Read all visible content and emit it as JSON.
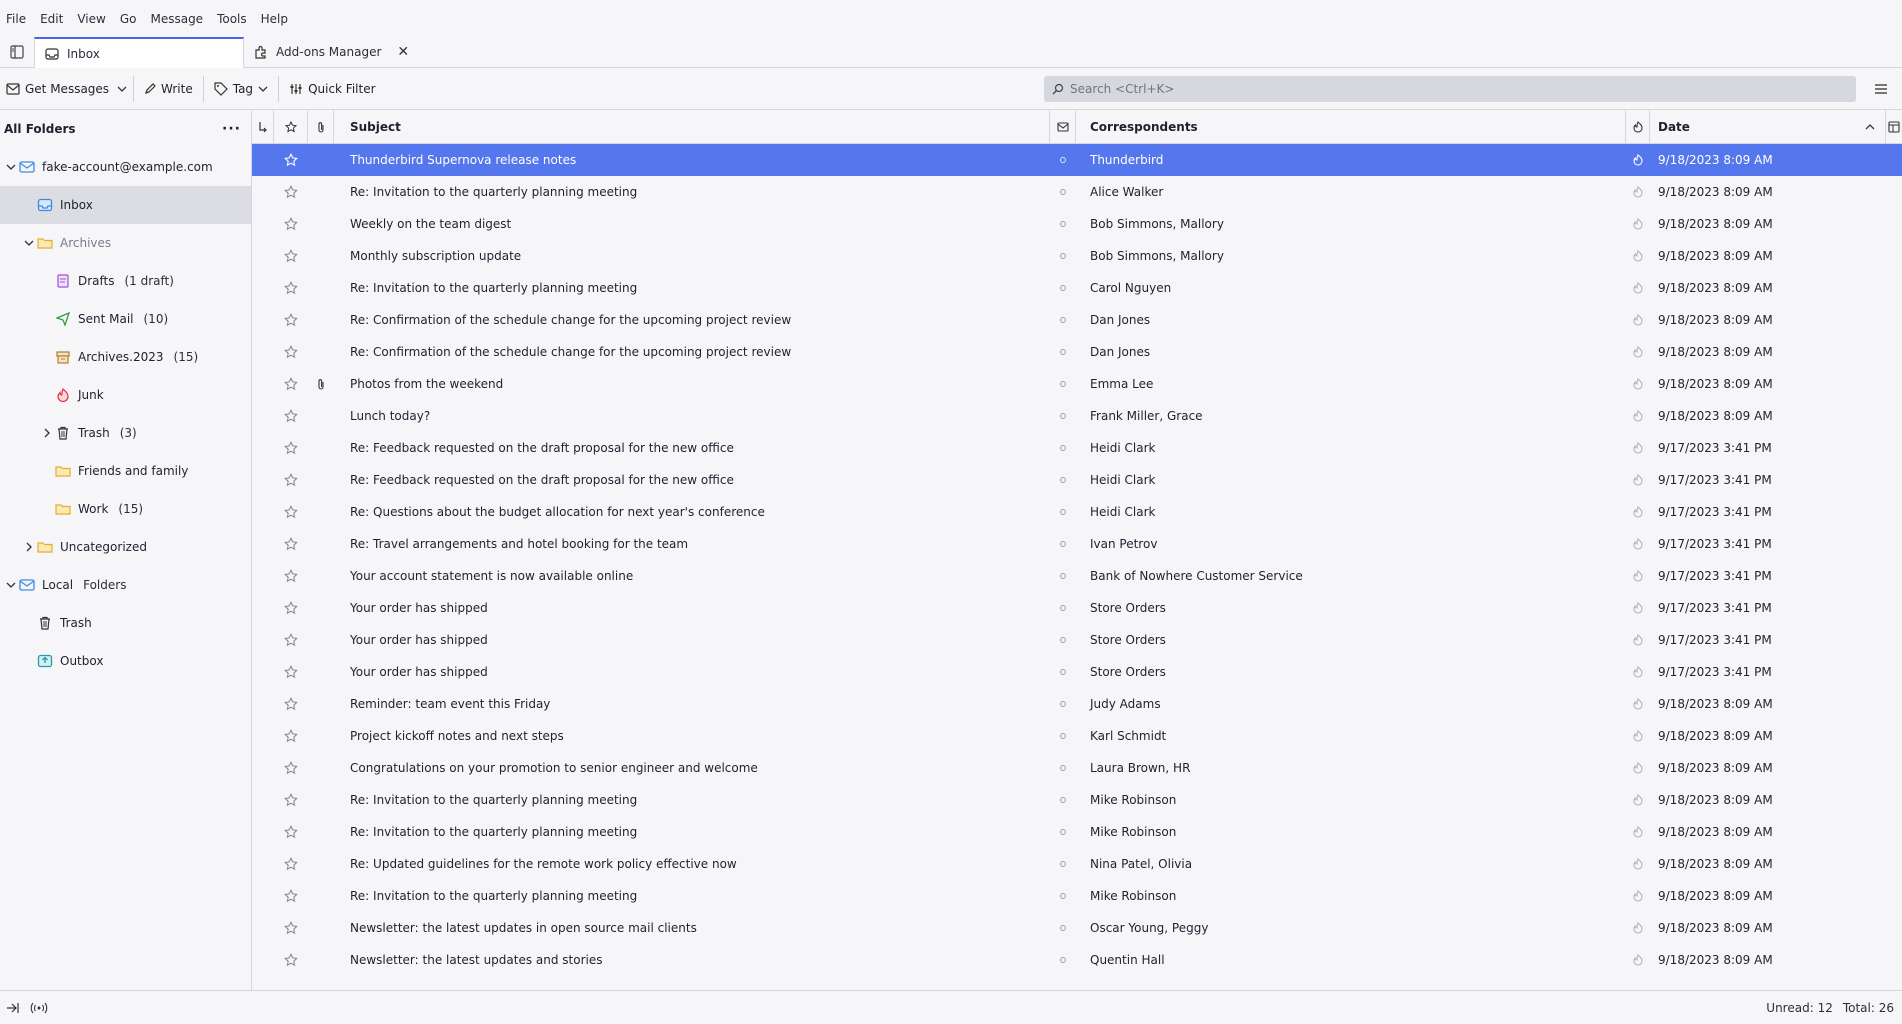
{
  "menubar": {
    "items": [
      "File",
      "Edit",
      "View",
      "Go",
      "Message",
      "Tools",
      "Help"
    ]
  },
  "tabs": [
    {
      "label": "Inbox",
      "active": true
    },
    {
      "label": "Add-ons Manager",
      "active": false
    }
  ],
  "toolbar": {
    "get_messages": "Get Messages",
    "write": "Write",
    "tag": "Tag",
    "quick_filter": "Quick Filter",
    "search_placeholder": "Search <Ctrl+K>"
  },
  "folder_pane": {
    "header": "All Folders",
    "folders": [
      {
        "label": "fake-account@example.com",
        "count": "",
        "level": 0,
        "twisty": "open",
        "icon": "account-icon",
        "color": "#3d8be0"
      },
      {
        "label": "Inbox",
        "count": "",
        "level": 1,
        "twisty": "",
        "icon": "inbox-icon",
        "color": "#3d8be0",
        "selected": true
      },
      {
        "label": "Archives",
        "count": "",
        "level": 1,
        "twisty": "open",
        "icon": "folder-icon",
        "color": "#e0b030",
        "muted": true
      },
      {
        "label": "Drafts",
        "count": "(1 draft)",
        "level": 2,
        "twisty": "",
        "icon": "drafts-icon",
        "color": "#a050d0"
      },
      {
        "label": "Sent Mail",
        "count": "(10)",
        "level": 2,
        "twisty": "",
        "icon": "sent-icon",
        "color": "#2fa040"
      },
      {
        "label": "Archives.2023",
        "count": "(15)",
        "level": 2,
        "twisty": "",
        "icon": "archive-icon",
        "color": "#b08030"
      },
      {
        "label": "Junk",
        "count": "",
        "level": 2,
        "twisty": "",
        "icon": "junk-icon",
        "color": "#e03040"
      },
      {
        "label": "Trash",
        "count": "(3)",
        "level": 2,
        "twisty": "closed",
        "icon": "trash-icon",
        "color": "#30323e"
      },
      {
        "label": "Friends and family",
        "count": "",
        "level": 2,
        "twisty": "",
        "icon": "folder-icon",
        "color": "#e0b030"
      },
      {
        "label": "Work",
        "count": "(15)",
        "level": 2,
        "twisty": "",
        "icon": "folder-icon",
        "color": "#e0b030"
      },
      {
        "label": "Uncategorized",
        "count": "",
        "level": 1,
        "twisty": "closed",
        "icon": "folder-icon",
        "color": "#e0b030"
      },
      {
        "label": "Local",
        "count": "Folders",
        "level": 0,
        "twisty": "open",
        "icon": "local-folders-icon",
        "color": "#3d8be0"
      },
      {
        "label": "Trash",
        "count": "",
        "level": 1,
        "twisty": "",
        "icon": "trash-icon",
        "color": "#30323e"
      },
      {
        "label": "Outbox",
        "count": "",
        "level": 1,
        "twisty": "",
        "icon": "outbox-icon",
        "color": "#2a9aaa"
      }
    ]
  },
  "message_list": {
    "columns": {
      "subject": "Subject",
      "correspondents": "Correspondents",
      "date": "Date"
    },
    "rows": [
      {
        "subject": "Thunderbird Supernova release notes",
        "from": "Thunderbird",
        "date": "9/18/2023 8:09 AM",
        "selected": true,
        "attachment": false
      },
      {
        "subject": "Re: Invitation to the quarterly planning meeting",
        "from": "Alice Walker",
        "date": "9/18/2023 8:09 AM",
        "attachment": false
      },
      {
        "subject": "Weekly on the team digest",
        "from": "Bob Simmons, Mallory",
        "date": "9/18/2023 8:09 AM",
        "attachment": false
      },
      {
        "subject": "Monthly subscription update",
        "from": "Bob Simmons, Mallory",
        "date": "9/18/2023 8:09 AM",
        "attachment": false
      },
      {
        "subject": "Re: Invitation to the quarterly planning meeting",
        "from": "Carol Nguyen",
        "date": "9/18/2023 8:09 AM",
        "attachment": false
      },
      {
        "subject": "Re: Confirmation of the schedule change for the upcoming project review",
        "from": "Dan Jones",
        "date": "9/18/2023 8:09 AM",
        "attachment": false
      },
      {
        "subject": "Re: Confirmation of the schedule change for the upcoming project review",
        "from": "Dan Jones",
        "date": "9/18/2023 8:09 AM",
        "attachment": false
      },
      {
        "subject": "Photos from the weekend",
        "from": "Emma Lee",
        "date": "9/18/2023 8:09 AM",
        "attachment": true
      },
      {
        "subject": "Lunch today?",
        "from": "Frank Miller, Grace",
        "date": "9/18/2023 8:09 AM",
        "attachment": false
      },
      {
        "subject": "Re: Feedback requested on the draft proposal for the new office",
        "from": "Heidi Clark",
        "date": "9/17/2023 3:41 PM",
        "attachment": false
      },
      {
        "subject": "Re: Feedback requested on the draft proposal for the new office",
        "from": "Heidi Clark",
        "date": "9/17/2023 3:41 PM",
        "attachment": false
      },
      {
        "subject": "Re: Questions about the budget allocation for next year's conference",
        "from": "Heidi Clark",
        "date": "9/17/2023 3:41 PM",
        "attachment": false
      },
      {
        "subject": "Re: Travel arrangements and hotel booking for the team",
        "from": "Ivan Petrov",
        "date": "9/17/2023 3:41 PM",
        "attachment": false
      },
      {
        "subject": "Your account statement is now available online",
        "from": "Bank of Nowhere Customer Service",
        "date": "9/17/2023 3:41 PM",
        "attachment": false
      },
      {
        "subject": "Your order has shipped",
        "from": "Store Orders",
        "date": "9/17/2023 3:41 PM",
        "attachment": false
      },
      {
        "subject": "Your order has shipped",
        "from": "Store Orders",
        "date": "9/17/2023 3:41 PM",
        "attachment": false
      },
      {
        "subject": "Your order has shipped",
        "from": "Store Orders",
        "date": "9/17/2023 3:41 PM",
        "attachment": false
      },
      {
        "subject": "Reminder: team event this Friday",
        "from": "Judy Adams",
        "date": "9/18/2023 8:09 AM",
        "attachment": false
      },
      {
        "subject": "Project kickoff notes and next steps",
        "from": "Karl Schmidt",
        "date": "9/18/2023 8:09 AM",
        "attachment": false
      },
      {
        "subject": "Congratulations on your promotion to senior engineer and welcome",
        "from": "Laura Brown, HR",
        "date": "9/18/2023 8:09 AM",
        "attachment": false
      },
      {
        "subject": "Re: Invitation to the quarterly planning meeting",
        "from": "Mike Robinson",
        "date": "9/18/2023 8:09 AM",
        "attachment": false
      },
      {
        "subject": "Re: Invitation to the quarterly planning meeting",
        "from": "Mike Robinson",
        "date": "9/18/2023 8:09 AM",
        "attachment": false
      },
      {
        "subject": "Re: Updated guidelines for the remote work policy effective now",
        "from": "Nina Patel, Olivia",
        "date": "9/18/2023 8:09 AM",
        "attachment": false
      },
      {
        "subject": "Re: Invitation to the quarterly planning meeting",
        "from": "Mike Robinson",
        "date": "9/18/2023 8:09 AM",
        "attachment": false
      },
      {
        "subject": "Newsletter: the latest updates in open source mail clients",
        "from": "Oscar Young, Peggy",
        "date": "9/18/2023 8:09 AM",
        "attachment": false
      },
      {
        "subject": "Newsletter: the latest updates and stories",
        "from": "Quentin Hall",
        "date": "9/18/2023 8:09 AM",
        "attachment": false
      }
    ]
  },
  "statusbar": {
    "unread": "Unread: 12",
    "total": "Total: 26"
  },
  "colors": {
    "accent": "#4a63e0",
    "selected_row": "#5577ee",
    "folder_selected": "#dcdde2"
  }
}
